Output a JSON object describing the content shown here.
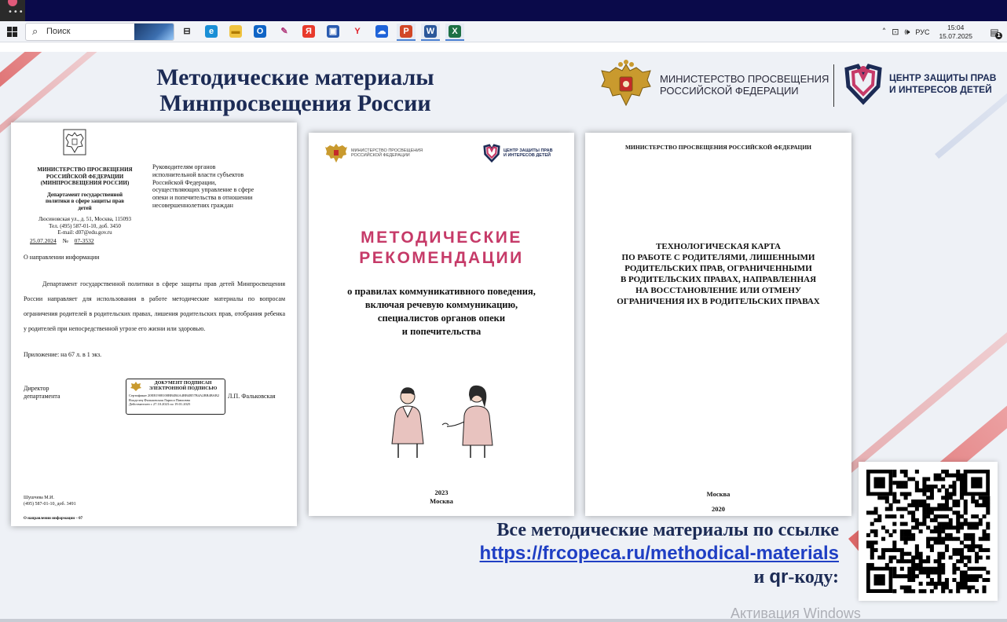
{
  "taskbar": {
    "search_placeholder": "Поиск",
    "search_icon": "search-icon",
    "apps": [
      {
        "name": "task-view",
        "label": "⊟",
        "color": "#f2f4f8",
        "fg": "#222"
      },
      {
        "name": "edge",
        "label": "e",
        "color": "#1a8fd6",
        "fg": "#fff"
      },
      {
        "name": "file-explorer",
        "label": "▬",
        "color": "#f0c340",
        "fg": "#b07b00"
      },
      {
        "name": "outlook",
        "label": "O",
        "color": "#0f64c6",
        "fg": "#fff"
      },
      {
        "name": "paint",
        "label": "✎",
        "color": "#f2f4f8",
        "fg": "#b0367a"
      },
      {
        "name": "yandex-browser",
        "label": "Я",
        "color": "#e83a2c",
        "fg": "#fff"
      },
      {
        "name": "store",
        "label": "▣",
        "color": "#2a5bb0",
        "fg": "#fff"
      },
      {
        "name": "yandex",
        "label": "Y",
        "color": "#f2f4f8",
        "fg": "#e0202a"
      },
      {
        "name": "disk",
        "label": "☁",
        "color": "#1f63d9",
        "fg": "#fff"
      },
      {
        "name": "powerpoint",
        "label": "P",
        "color": "#d24726",
        "fg": "#fff"
      },
      {
        "name": "word",
        "label": "W",
        "color": "#2b579a",
        "fg": "#fff"
      },
      {
        "name": "excel",
        "label": "X",
        "color": "#1d7044",
        "fg": "#fff"
      }
    ],
    "tray": {
      "chevron": "˄",
      "network": "⊡",
      "volume": "🕪",
      "lang": "РУС",
      "time": "15:04",
      "date": "15.07.2025",
      "notif_count": "1"
    }
  },
  "slide": {
    "title_line1": "Методические материалы",
    "title_line2": "Минпросвещения России",
    "ministry_line1": "МИНИСТЕРСТВО ПРОСВЕЩЕНИЯ",
    "ministry_line2": "РОССИЙСКОЙ ФЕДЕРАЦИИ",
    "center_line1": "ЦЕНТР ЗАЩИТЫ ПРАВ",
    "center_line2": "И ИНТЕРЕСОВ ДЕТЕЙ",
    "cta_line1": "Все методические материалы по ссылке",
    "cta_link": "https://frcopeca.ru/methodical-materials",
    "cta_line3_pre": "и ",
    "cta_line3_qr": "qr",
    "cta_line3_post": "-коду:",
    "watermark": "Активация Windows"
  },
  "letter": {
    "org1": "МИНИСТЕРСТВО ПРОСВЕЩЕНИЯ",
    "org2": "РОССИЙСКОЙ ФЕДЕРАЦИИ",
    "org3": "(МИНПРОСВЕЩЕНИЯ РОССИИ)",
    "dept1": "Департамент государственной",
    "dept2": "политики в сфере защиты прав",
    "dept3": "детей",
    "addr1": "Люсиновская ул., д. 51, Москва, 115093",
    "addr2": "Тел. (495) 587-01-10, доб. 3450",
    "addr3": "E-mail: d07@edu.gov.ru",
    "date": "25.07.2024",
    "num_label": "№",
    "num": "07-3532",
    "to1": "Руководителям органов",
    "to2": "исполнительной власти субъектов",
    "to3": "Российской Федерации,",
    "to4": "осуществляющих управление в сфере",
    "to5": "опеки и попечительства в отношении",
    "to6": "несовершеннолетних граждан",
    "subject": "О направлении информации",
    "body": "Департамент государственной политики в сфере защиты прав детей Минпросвещения России направляет для использования в работе методические материалы по вопросам ограничения родителей в родительских правах, лишения родительских прав, отобрания ребенка у родителей при непосредственной угрозе его жизни или здоровью.",
    "appendix": "Приложение: на 67 л. в 1 экз.",
    "signer1": "Директор",
    "signer2": "департамента",
    "stamp1": "ДОКУМЕНТ ПОДПИСАН",
    "stamp2": "ЭЛЕКТРОННОЙ ПОДПИСЬЮ",
    "stamp3": "Сертификат 20ЕВ1908100ВВ4В4А4ВВ4В57В4А2ВВ4ВАВ2",
    "stamp4": "Владелец Фальковская Лариса Павловна",
    "stamp5": "Действителен с 27.10.2023 по 19.01.2025",
    "signer_name": "Л.П. Фальковская",
    "exec1": "Шушчева М.И.",
    "exec2": "(495) 587-01-10, доб. 3491",
    "footer": "О направлении информации – 07"
  },
  "brochure": {
    "min1": "МИНИСТЕРСТВО ПРОСВЕЩЕНИЯ",
    "min2": "РОССИЙСКОЙ ФЕДЕРАЦИИ",
    "ctr1": "ЦЕНТР ЗАЩИТЫ ПРАВ",
    "ctr2": "И ИНТЕРЕСОВ ДЕТЕЙ",
    "big1": "МЕТОДИЧЕСКИЕ",
    "big2": "РЕКОМЕНДАЦИИ",
    "sub1": "о правилах коммуникативного поведения,",
    "sub2": "включая речевую коммуникацию,",
    "sub3": "специалистов органов опеки",
    "sub4": "и попечительства",
    "year": "2023",
    "city": "Москва"
  },
  "techcard": {
    "header": "МИНИСТЕРСТВО ПРОСВЕЩЕНИЯ РОССИЙСКОЙ ФЕДЕРАЦИИ",
    "t1": "ТЕХНОЛОГИЧЕСКАЯ КАРТА",
    "t2": "ПО РАБОТЕ С РОДИТЕЛЯМИ, ЛИШЕННЫМИ",
    "t3": "РОДИТЕЛЬСКИХ ПРАВ, ОГРАНИЧЕННЫМИ",
    "t4": "В РОДИТЕЛЬСКИХ ПРАВАХ, НАПРАВЛЕННАЯ",
    "t5": "НА ВОССТАНОВЛЕНИЕ ИЛИ ОТМЕНУ",
    "t6": "ОГРАНИЧЕНИЯ ИХ В РОДИТЕЛЬСКИХ ПРАВАХ",
    "city": "Москва",
    "year": "2020"
  },
  "colors": {
    "title": "#1c2b55",
    "accent_red": "#d63a3a",
    "brochure_pink": "#c63a68",
    "link_blue": "#1f3fc4"
  }
}
